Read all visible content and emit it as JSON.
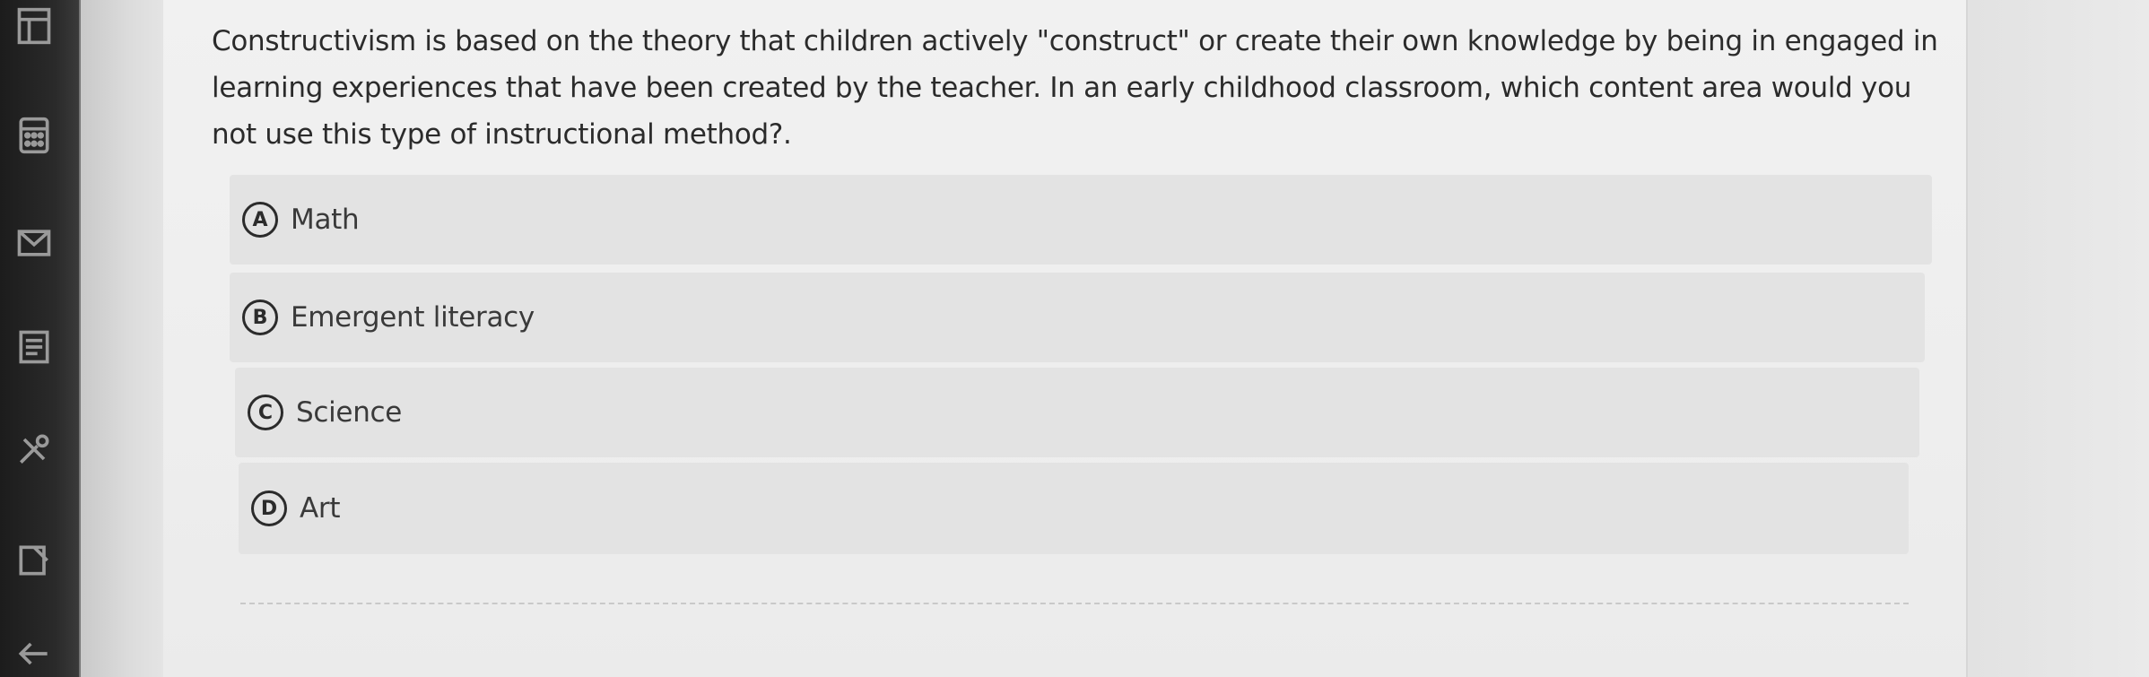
{
  "question": {
    "text": "Constructivism is based on the theory that children actively \"construct\" or create their own knowledge by being in engaged in learning experiences that have been created by the teacher. In an early childhood classroom, which content area would you not use this type of instructional method?."
  },
  "options": [
    {
      "letter": "A",
      "label": "Math"
    },
    {
      "letter": "B",
      "label": "Emergent literacy"
    },
    {
      "letter": "C",
      "label": "Science"
    },
    {
      "letter": "D",
      "label": "Art"
    }
  ],
  "rail_icons": [
    "grid-icon",
    "calculator-icon",
    "mail-icon",
    "list-icon",
    "tools-icon",
    "edit-icon",
    "back-icon"
  ]
}
